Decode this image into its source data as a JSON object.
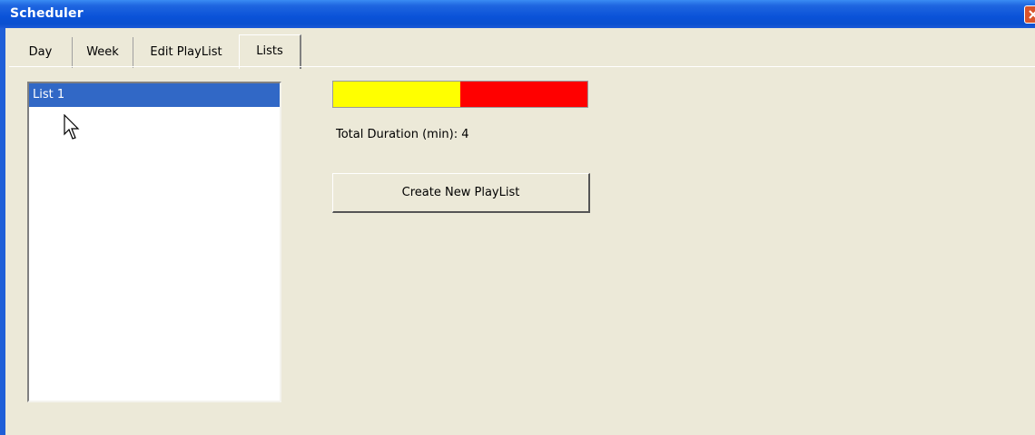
{
  "window": {
    "title": "Scheduler"
  },
  "tabs": [
    {
      "label": "Day",
      "active": false
    },
    {
      "label": "Week",
      "active": false
    },
    {
      "label": "Edit PlayList",
      "active": false
    },
    {
      "label": "Lists",
      "active": true
    }
  ],
  "lists": {
    "items": [
      {
        "label": "List 1",
        "selected": true
      }
    ]
  },
  "duration_bar": {
    "fill_fraction": 0.5,
    "fill_color": "#ffff00",
    "background_color": "#ff0000"
  },
  "duration": {
    "label": "Total Duration (min): 4"
  },
  "buttons": {
    "create_label": "Create New PlayList"
  },
  "colors": {
    "titlebar": "#0a52d8",
    "selection": "#3168c6",
    "window_bg": "#ece9d8"
  }
}
